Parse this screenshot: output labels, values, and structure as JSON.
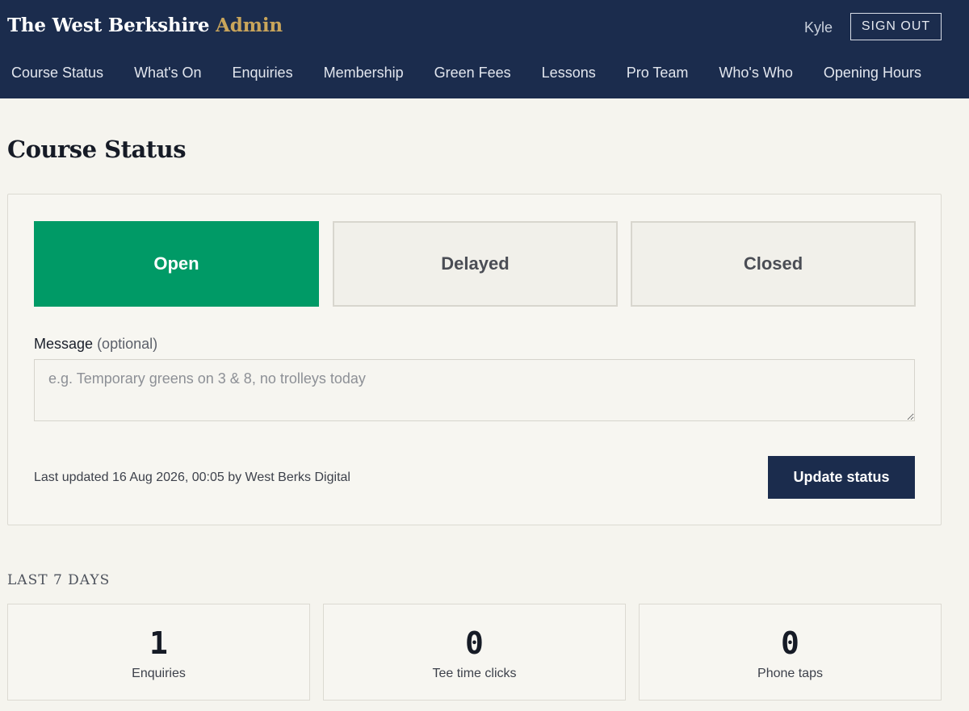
{
  "header": {
    "brand_main": "The West Berkshire",
    "brand_accent": "Admin",
    "user": "Kyle",
    "sign_out_label": "SIGN OUT"
  },
  "nav": {
    "items": [
      "Course Status",
      "What's On",
      "Enquiries",
      "Membership",
      "Green Fees",
      "Lessons",
      "Pro Team",
      "Who's Who",
      "Opening Hours"
    ]
  },
  "page": {
    "title": "Course Status"
  },
  "status_card": {
    "options": {
      "open": "Open",
      "delayed": "Delayed",
      "closed": "Closed"
    },
    "selected": "Open",
    "message_label": "Message",
    "message_optional": "(optional)",
    "message_value": "",
    "message_placeholder": "e.g. Temporary greens on 3 & 8, no trolleys today",
    "last_updated": "Last updated 16 Aug 2026, 00:05 by West Berks Digital",
    "update_label": "Update status"
  },
  "stats": {
    "section_label": "LAST 7 DAYS",
    "items": [
      {
        "value": "1",
        "label": "Enquiries"
      },
      {
        "value": "0",
        "label": "Tee time clicks"
      },
      {
        "value": "0",
        "label": "Phone taps"
      }
    ]
  },
  "colors": {
    "header_bg": "#1b2c4d",
    "brand_accent": "#c9a55b",
    "open_green": "#009a66",
    "page_bg": "#f5f4ee"
  }
}
